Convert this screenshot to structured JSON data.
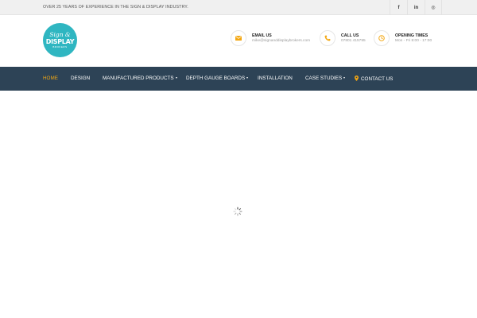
{
  "topbar": {
    "tagline": "OVER 25 YEARS OF EXPERIENCE IN THE SIGN & DISPLAY INDUSTRY.",
    "social": [
      {
        "icon": "facebook-icon",
        "glyph": "f"
      },
      {
        "icon": "linkedin-icon",
        "glyph": "in"
      },
      {
        "icon": "instagram-icon",
        "glyph": "◎"
      }
    ]
  },
  "logo": {
    "line1": "Sign &",
    "line2": "DISPLAY",
    "line3": "BROKERS",
    "color": "#2fb6c1"
  },
  "contact": {
    "email": {
      "title": "EMAIL US",
      "value": "mike@signanddisplaybrokers.com",
      "icon": "envelope-icon"
    },
    "call": {
      "title": "CALL US",
      "value": "07801 415795",
      "icon": "phone-icon"
    },
    "hours": {
      "title": "OPENING TIMES",
      "value": "Mon - Fri 8:00 - 17:00",
      "icon": "clock-icon"
    },
    "accent": "#f3a712"
  },
  "nav": {
    "background": "#2d4356",
    "active_color": "#f3a712",
    "items": [
      {
        "label": "HOME",
        "active": true,
        "dropdown": false
      },
      {
        "label": "DESIGN",
        "active": false,
        "dropdown": false
      },
      {
        "label": "MANUFACTURED PRODUCTS",
        "active": false,
        "dropdown": true
      },
      {
        "label": "DEPTH GAUGE BOARDS",
        "active": false,
        "dropdown": true
      },
      {
        "label": "INSTALLATION",
        "active": false,
        "dropdown": false
      },
      {
        "label": "CASE STUDIES",
        "active": false,
        "dropdown": true
      },
      {
        "label": "CONTACT US",
        "active": false,
        "dropdown": false,
        "icon": "map-marker-icon"
      }
    ]
  },
  "main": {
    "loading_icon": "loading-spinner-icon"
  }
}
